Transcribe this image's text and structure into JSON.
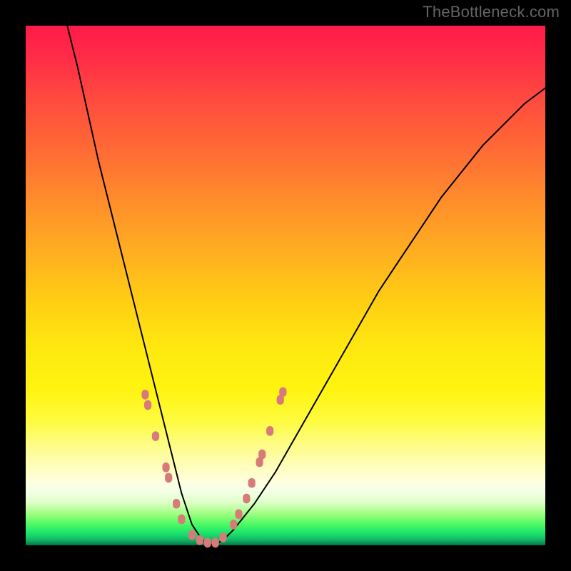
{
  "watermark": "TheBottleneck.com",
  "colors": {
    "background": "#000000",
    "curve": "#000000",
    "points": "#d97a7a"
  },
  "chart_data": {
    "type": "line",
    "title": "",
    "xlabel": "",
    "ylabel": "",
    "xlim": [
      0,
      100
    ],
    "ylim": [
      0,
      100
    ],
    "series": [
      {
        "name": "bottleneck-curve",
        "x": [
          8,
          10,
          12,
          14,
          16,
          18,
          20,
          22,
          24,
          26,
          28,
          30,
          32,
          34,
          36,
          38,
          40,
          44,
          48,
          52,
          56,
          60,
          64,
          68,
          72,
          76,
          80,
          84,
          88,
          92,
          96,
          100
        ],
        "y": [
          100,
          92,
          83,
          74,
          66,
          58,
          50,
          42,
          34,
          26,
          18,
          10,
          4,
          1,
          0,
          1,
          3,
          8,
          14,
          21,
          28,
          35,
          42,
          49,
          55,
          61,
          67,
          72,
          77,
          81,
          85,
          88
        ]
      }
    ],
    "points": [
      {
        "x": 23,
        "y": 29
      },
      {
        "x": 23.5,
        "y": 27
      },
      {
        "x": 25,
        "y": 21
      },
      {
        "x": 27,
        "y": 15
      },
      {
        "x": 27.5,
        "y": 13
      },
      {
        "x": 29,
        "y": 8
      },
      {
        "x": 30,
        "y": 5
      },
      {
        "x": 32,
        "y": 2
      },
      {
        "x": 33.5,
        "y": 1
      },
      {
        "x": 35,
        "y": 0.5
      },
      {
        "x": 36.5,
        "y": 0.5
      },
      {
        "x": 38,
        "y": 1.5
      },
      {
        "x": 40,
        "y": 4
      },
      {
        "x": 41,
        "y": 6
      },
      {
        "x": 42.5,
        "y": 9
      },
      {
        "x": 43.5,
        "y": 12
      },
      {
        "x": 45,
        "y": 16
      },
      {
        "x": 45.5,
        "y": 17.5
      },
      {
        "x": 47,
        "y": 22
      },
      {
        "x": 49,
        "y": 28
      },
      {
        "x": 49.5,
        "y": 29.5
      }
    ],
    "annotations": []
  }
}
